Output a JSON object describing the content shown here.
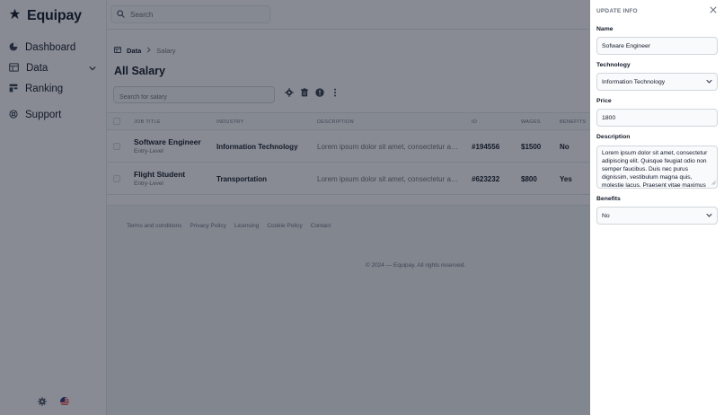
{
  "app": {
    "name": "Equipay"
  },
  "topbar": {
    "search_placeholder": "Search"
  },
  "sidebar": {
    "items": [
      {
        "label": "Dashboard",
        "icon": "pie-chart-icon"
      },
      {
        "label": "Data",
        "icon": "table-icon",
        "expandable": true
      },
      {
        "label": "Ranking",
        "icon": "ranking-icon"
      },
      {
        "label": "Support",
        "icon": "lifebuoy-icon"
      }
    ],
    "bottom_icons": [
      "gear-icon",
      "us-flag-icon"
    ]
  },
  "breadcrumb": {
    "section": "Data",
    "current": "Salary"
  },
  "page": {
    "title": "All Salary",
    "table_search_placeholder": "Search for salary",
    "toolbar_icons": [
      "settings-icon",
      "trash-icon",
      "alert-icon",
      "more-vertical-icon"
    ]
  },
  "table": {
    "headers": [
      "JOB TITLE",
      "INDUSTRY",
      "DESCRIPTION",
      "ID",
      "WAGES",
      "BENEFITS"
    ],
    "rows": [
      {
        "title": "Software Engineer",
        "level": "Entry-Level",
        "industry": "Information Technology",
        "description": "Lorem ipsum dolor sit amet, consectetur adipiscing elit.",
        "id": "#194556",
        "wages": "$1500",
        "benefits": "No"
      },
      {
        "title": "Flight Student",
        "level": "Entry-Level",
        "industry": "Transportation",
        "description": "Lorem ipsum dolor sit amet, consectetur adipiscing elit.",
        "id": "#623232",
        "wages": "$800",
        "benefits": "Yes"
      }
    ]
  },
  "footer": {
    "links": [
      "Terms and conditions",
      "Privacy Policy",
      "Licensing",
      "Cookie Policy",
      "Contact"
    ],
    "copyright": "© 2024 — Equipay. All rights reserved."
  },
  "drawer": {
    "title": "UPDATE INFO",
    "name": {
      "label": "Name",
      "value": "Sofware Engineer"
    },
    "technology": {
      "label": "Technology",
      "value": "Information Technology"
    },
    "price": {
      "label": "Price",
      "value": "1800"
    },
    "description": {
      "label": "Description",
      "value": "Lorem ipsum dolor sit amet, consectetur adipiscing elit. Quisque feugiat odio non semper faucibus. Duis nec purus dignissim, vestibulum magna quis, molestie lacus. Praesent vitae maximus"
    },
    "benefits": {
      "label": "Benefits",
      "value": "No"
    }
  },
  "colors": {
    "accent": "#111827",
    "overlay": "#111827",
    "muted": "#6b7280",
    "border": "#e5e7eb"
  }
}
